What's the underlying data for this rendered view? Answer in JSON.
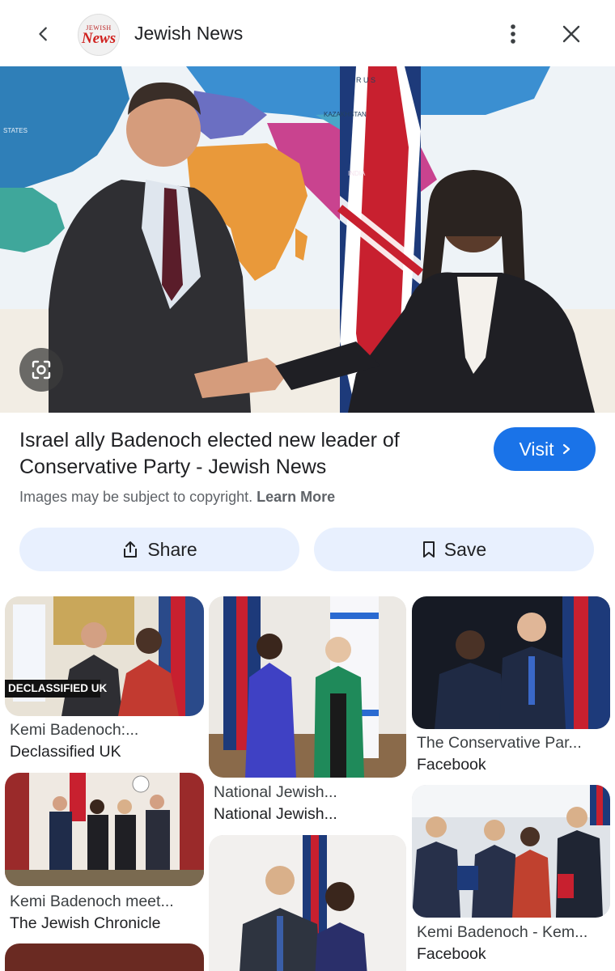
{
  "header": {
    "site_name": "Jewish News",
    "logo_line1": "JEWISH",
    "logo_line2": "News"
  },
  "hero": {
    "map_labels": [
      "R U S",
      "KAZAKHSTAN",
      "STATES",
      "INDIA"
    ]
  },
  "result": {
    "title": "Israel ally Badenoch elected new leader of Conservative Party - Jewish News",
    "visit_label": "Visit",
    "copyright_text": "Images may be subject to copyright.",
    "learn_more": "Learn More"
  },
  "actions": {
    "share_label": "Share",
    "save_label": "Save"
  },
  "related": [
    {
      "title": "Kemi Badenoch:...",
      "source": "Declassified UK",
      "overlay": "DECLASSIFIED UK"
    },
    {
      "title": "National Jewish...",
      "source": "National Jewish..."
    },
    {
      "title": "The Conservative Par...",
      "source": "Facebook"
    },
    {
      "title": "Kemi Badenoch meet...",
      "source": "The Jewish Chronicle"
    },
    {
      "title": "Kemi Badenoch - Kem...",
      "source": "Facebook"
    }
  ],
  "colors": {
    "accent": "#1a73e8",
    "chip_bg": "#e8f0fe"
  }
}
